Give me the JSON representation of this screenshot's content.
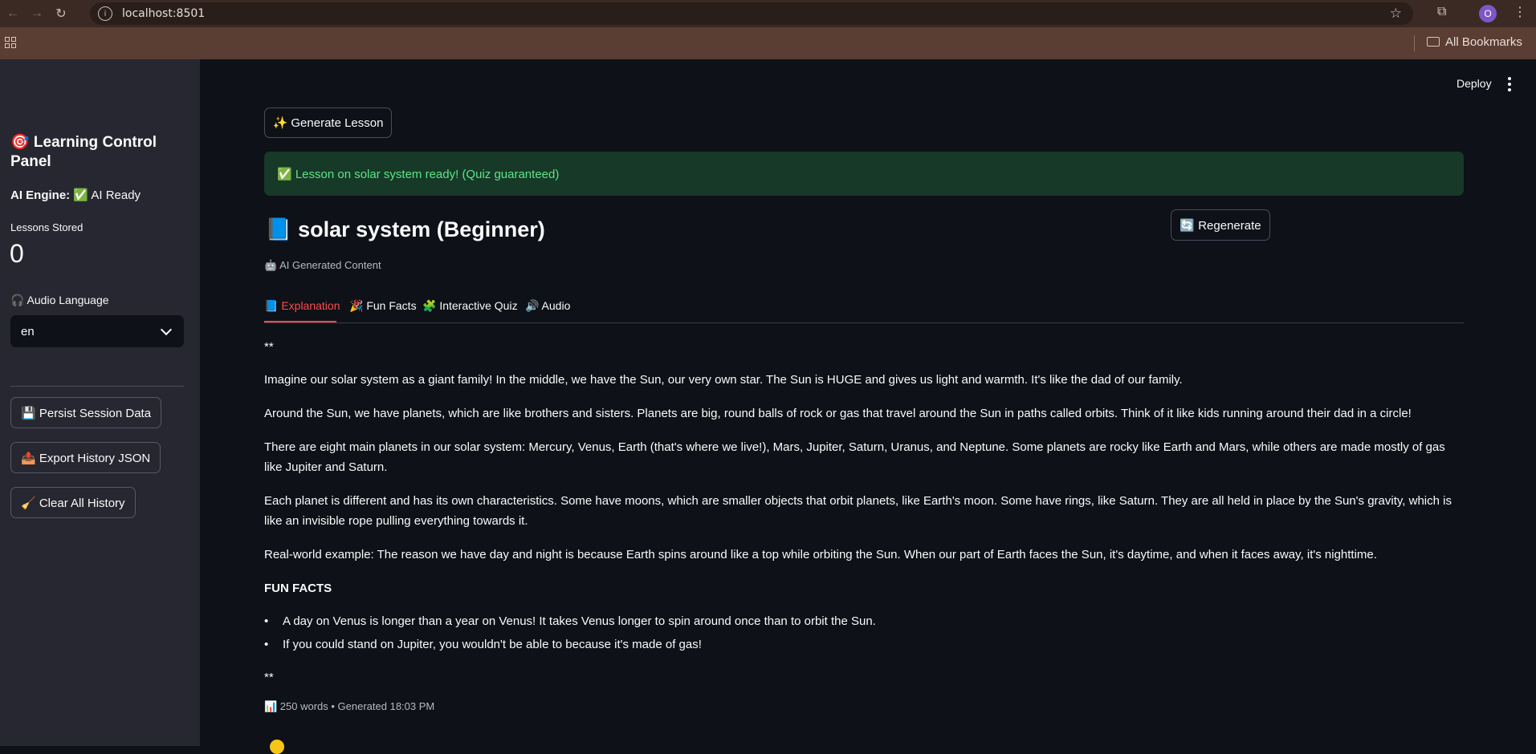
{
  "browser": {
    "url": "localhost:8501",
    "profile_initial": "O",
    "bookmarks_label": "All Bookmarks"
  },
  "sidebar": {
    "title": "🎯 Learning Control Panel",
    "engine_label": "AI Engine:",
    "engine_status": "✅ AI Ready",
    "metric_label": "Lessons Stored",
    "metric_value": "0",
    "audio_label": "🎧 Audio Language",
    "audio_selected": "en",
    "buttons": {
      "persist": "💾 Persist Session Data",
      "export": "📤 Export History JSON",
      "clear": "🧹 Clear All History"
    }
  },
  "main": {
    "deploy_label": "Deploy",
    "generate_button": "✨ Generate Lesson",
    "success_message": "✅ Lesson on solar system ready! (Quiz guaranteed)",
    "lesson_title": "📘 solar system (Beginner)",
    "regenerate_button": "🔄 Regenerate",
    "ai_caption": "🤖 AI Generated Content",
    "tabs": [
      {
        "label": "📘 Explanation"
      },
      {
        "label": "🎉 Fun Facts"
      },
      {
        "label": "🧩 Interactive Quiz"
      },
      {
        "label": "🔊 Audio"
      }
    ],
    "content": {
      "star_top": "**",
      "paragraphs": [
        "Imagine our solar system as a giant family! In the middle, we have the Sun, our very own star. The Sun is HUGE and gives us light and warmth. It's like the dad of our family.",
        "Around the Sun, we have planets, which are like brothers and sisters. Planets are big, round balls of rock or gas that travel around the Sun in paths called orbits. Think of it like kids running around their dad in a circle!",
        "There are eight main planets in our solar system: Mercury, Venus, Earth (that's where we live!), Mars, Jupiter, Saturn, Uranus, and Neptune. Some planets are rocky like Earth and Mars, while others are made mostly of gas like Jupiter and Saturn.",
        "Each planet is different and has its own characteristics. Some have moons, which are smaller objects that orbit planets, like Earth's moon. Some have rings, like Saturn. They are all held in place by the Sun's gravity, which is like an invisible rope pulling everything towards it.",
        "Real-world example: The reason we have day and night is because Earth spins around like a top while orbiting the Sun. When our part of Earth faces the Sun, it's daytime, and when it faces away, it's nighttime."
      ],
      "fun_facts_heading": "FUN FACTS",
      "fun_facts": [
        "A day on Venus is longer than a year on Venus! It takes Venus longer to spin around once than to orbit the Sun.",
        "If you could stand on Jupiter, you wouldn't be able to because it's made of gas!"
      ],
      "star_bottom": "**"
    },
    "footer_caption": "📊 250 words • Generated 18:03 PM"
  }
}
